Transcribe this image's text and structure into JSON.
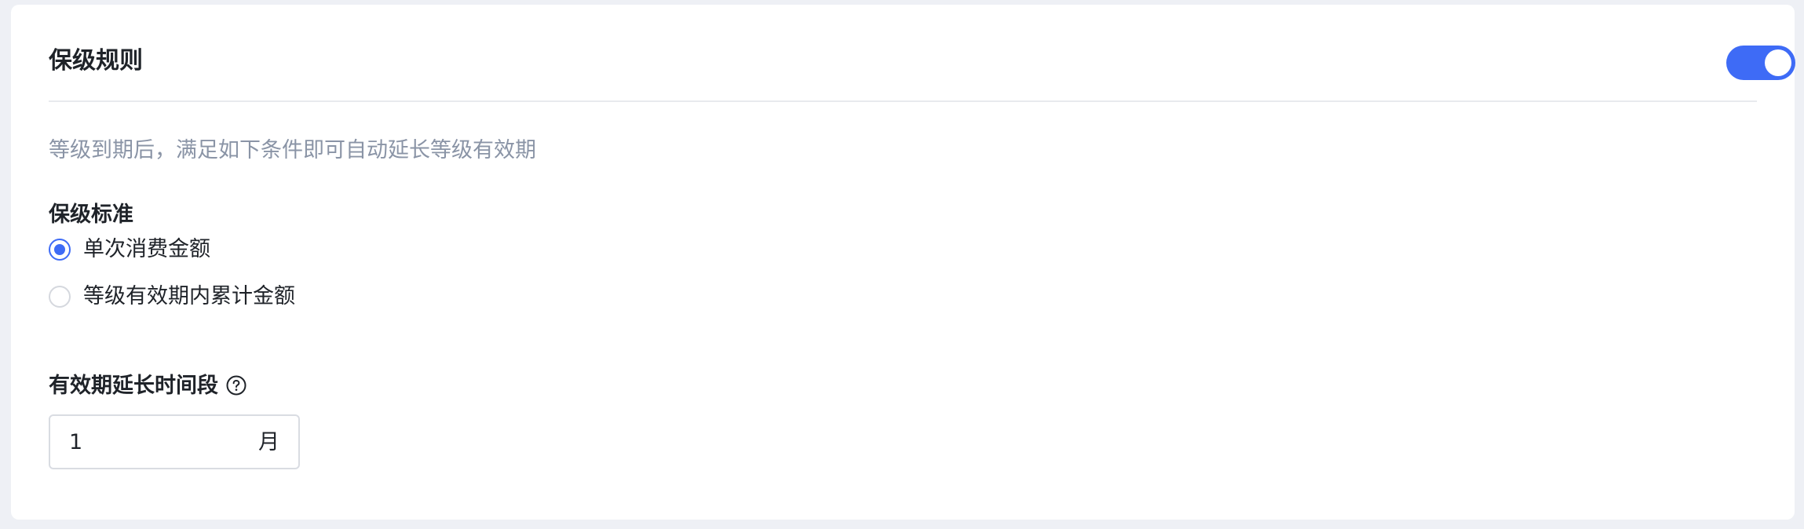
{
  "card": {
    "title": "保级规则",
    "toggle_on": true,
    "description": "等级到期后，满足如下条件即可自动延长等级有效期"
  },
  "standard": {
    "label": "保级标准",
    "options": [
      {
        "label": "单次消费金额",
        "checked": true
      },
      {
        "label": "等级有效期内累计金额",
        "checked": false
      }
    ]
  },
  "extension": {
    "label": "有效期延长时间段",
    "value": "1",
    "unit": "月"
  },
  "colors": {
    "accent": "#3e6bf6",
    "text": "#1f2329",
    "muted": "#8a94a6",
    "background": "#eef0f5"
  },
  "icons": {
    "help": "question-circle-icon"
  }
}
